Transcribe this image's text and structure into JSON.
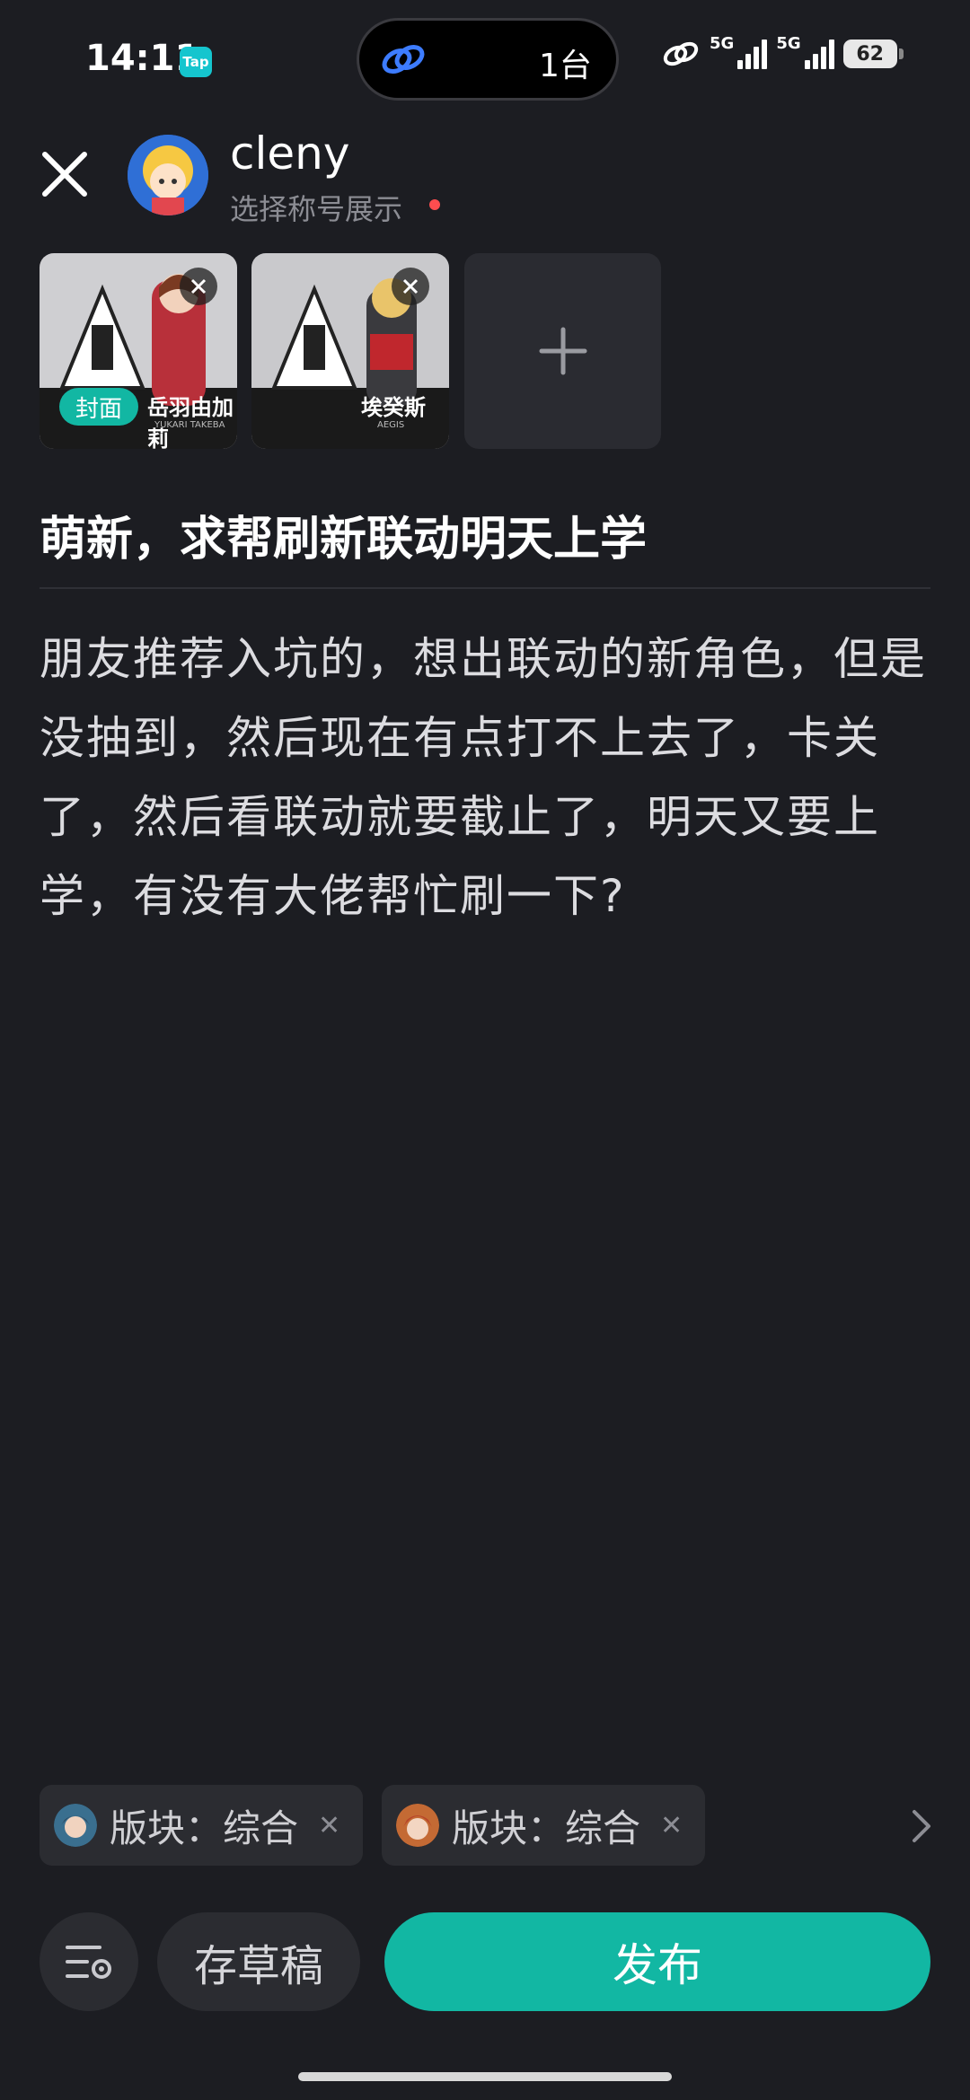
{
  "status_bar": {
    "time": "14:11",
    "app_badge": "Tap",
    "island_text": "1台",
    "network_1": "5G",
    "network_2": "5G",
    "battery": "62"
  },
  "header": {
    "username": "cleny",
    "subtitle": "选择称号展示"
  },
  "images": {
    "cover_label": "封面",
    "items": [
      {
        "character": "岳羽由加莉",
        "romanized": "YUKARI TAKEBA"
      },
      {
        "character": "埃癸斯",
        "romanized": "AEGIS"
      }
    ]
  },
  "post": {
    "title": "萌新，求帮刷新联动明天上学",
    "body": "朋友推荐入坑的，想出联动的新角色，但是没抽到，然后现在有点打不上去了，卡关了，然后看联动就要截止了，明天又要上学，有没有大佬帮忙刷一下?"
  },
  "tags": [
    {
      "label": "版块：综合"
    },
    {
      "label": "版块：综合"
    }
  ],
  "actions": {
    "draft": "存草稿",
    "publish": "发布"
  },
  "colors": {
    "background": "#1c1d22",
    "accent": "#12b7a3",
    "notice_dot": "#ff4d4f"
  }
}
